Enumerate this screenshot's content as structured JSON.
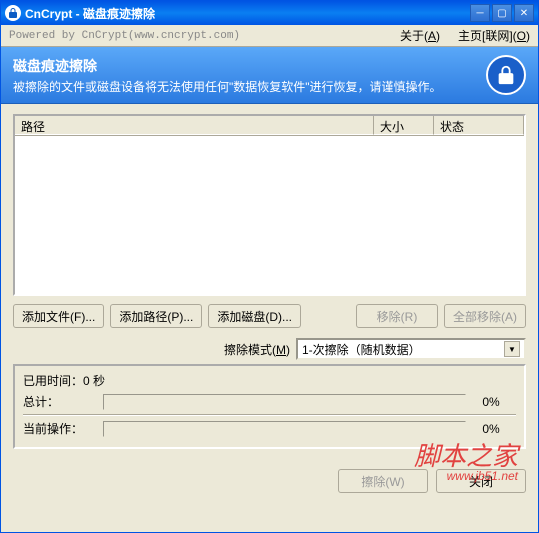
{
  "titlebar": {
    "title": "CnCrypt - 磁盘痕迹擦除"
  },
  "toolbar": {
    "powered": "Powered by CnCrypt(www.cncrypt.com)",
    "about": "关于(A)",
    "home": "主页[联网](O)"
  },
  "banner": {
    "heading": "磁盘痕迹擦除",
    "sub": "被擦除的文件或磁盘设备将无法使用任何\"数据恢复软件\"进行恢复，请谨慎操作。"
  },
  "list": {
    "col_path": "路径",
    "col_size": "大小",
    "col_status": "状态"
  },
  "buttons": {
    "add_file": "添加文件(F)...",
    "add_path": "添加路径(P)...",
    "add_disk": "添加磁盘(D)...",
    "remove": "移除(R)",
    "remove_all": "全部移除(A)"
  },
  "mode": {
    "label": "擦除模式(M)",
    "value": "1-次擦除（随机数据）"
  },
  "status": {
    "elapsed": "已用时间：0 秒",
    "total_label": "总计：",
    "total_pct": "0%",
    "current_label": "当前操作：",
    "current_pct": "0%"
  },
  "footer": {
    "wipe": "擦除(W)",
    "close": "关闭"
  },
  "watermark": {
    "text": "脚本之家",
    "url": "www.jb51.net"
  }
}
